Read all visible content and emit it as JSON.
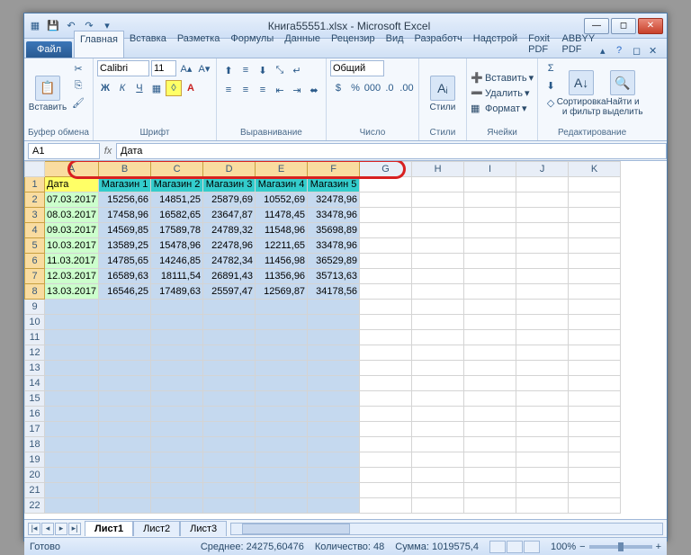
{
  "title": "Книга55551.xlsx - Microsoft Excel",
  "tabs": {
    "file": "Файл",
    "list": [
      "Главная",
      "Вставка",
      "Разметка",
      "Формулы",
      "Данные",
      "Рецензир",
      "Вид",
      "Разработч",
      "Надстрой",
      "Foxit PDF",
      "ABBYY PDF"
    ],
    "active": 0
  },
  "ribbon": {
    "paste": "Вставить",
    "clipboard": "Буфер обмена",
    "font_name": "Calibri",
    "font_size": "11",
    "font": "Шрифт",
    "align": "Выравнивание",
    "number_fmt": "Общий",
    "number": "Число",
    "styles": "Стили",
    "styles_btn": "Стили",
    "cells": "Ячейки",
    "insert": "Вставить",
    "delete": "Удалить",
    "format": "Формат",
    "editing": "Редактирование",
    "sort": "Сортировка и фильтр",
    "find": "Найти и выделить"
  },
  "formula": {
    "cell": "A1",
    "value": "Дата"
  },
  "columns": [
    "A",
    "B",
    "C",
    "D",
    "E",
    "F",
    "G",
    "H",
    "I",
    "J",
    "K"
  ],
  "sel_cols": 6,
  "rows_shown": 22,
  "data_rows": 8,
  "headers": [
    "Дата",
    "Магазин 1",
    "Магазин 2",
    "Магазин 3",
    "Магазин 4",
    "Магазин 5"
  ],
  "data": [
    [
      "07.03.2017",
      "15256,66",
      "14851,25",
      "25879,69",
      "10552,69",
      "32478,96"
    ],
    [
      "08.03.2017",
      "17458,96",
      "16582,65",
      "23647,87",
      "11478,45",
      "33478,96"
    ],
    [
      "09.03.2017",
      "14569,85",
      "17589,78",
      "24789,32",
      "11548,96",
      "35698,89"
    ],
    [
      "10.03.2017",
      "13589,25",
      "15478,96",
      "22478,96",
      "12211,65",
      "33478,96"
    ],
    [
      "11.03.2017",
      "14785,65",
      "14246,85",
      "24782,34",
      "11456,98",
      "36529,89"
    ],
    [
      "12.03.2017",
      "16589,63",
      "18111,54",
      "26891,43",
      "11356,96",
      "35713,63"
    ],
    [
      "13.03.2017",
      "16546,25",
      "17489,63",
      "25597,47",
      "12569,87",
      "34178,56"
    ]
  ],
  "sheets": {
    "list": [
      "Лист1",
      "Лист2",
      "Лист3"
    ],
    "active": 0
  },
  "status": {
    "ready": "Готово",
    "avg_lbl": "Среднее:",
    "avg": "24275,60476",
    "cnt_lbl": "Количество:",
    "cnt": "48",
    "sum_lbl": "Сумма:",
    "sum": "1019575,4",
    "zoom": "100%"
  }
}
